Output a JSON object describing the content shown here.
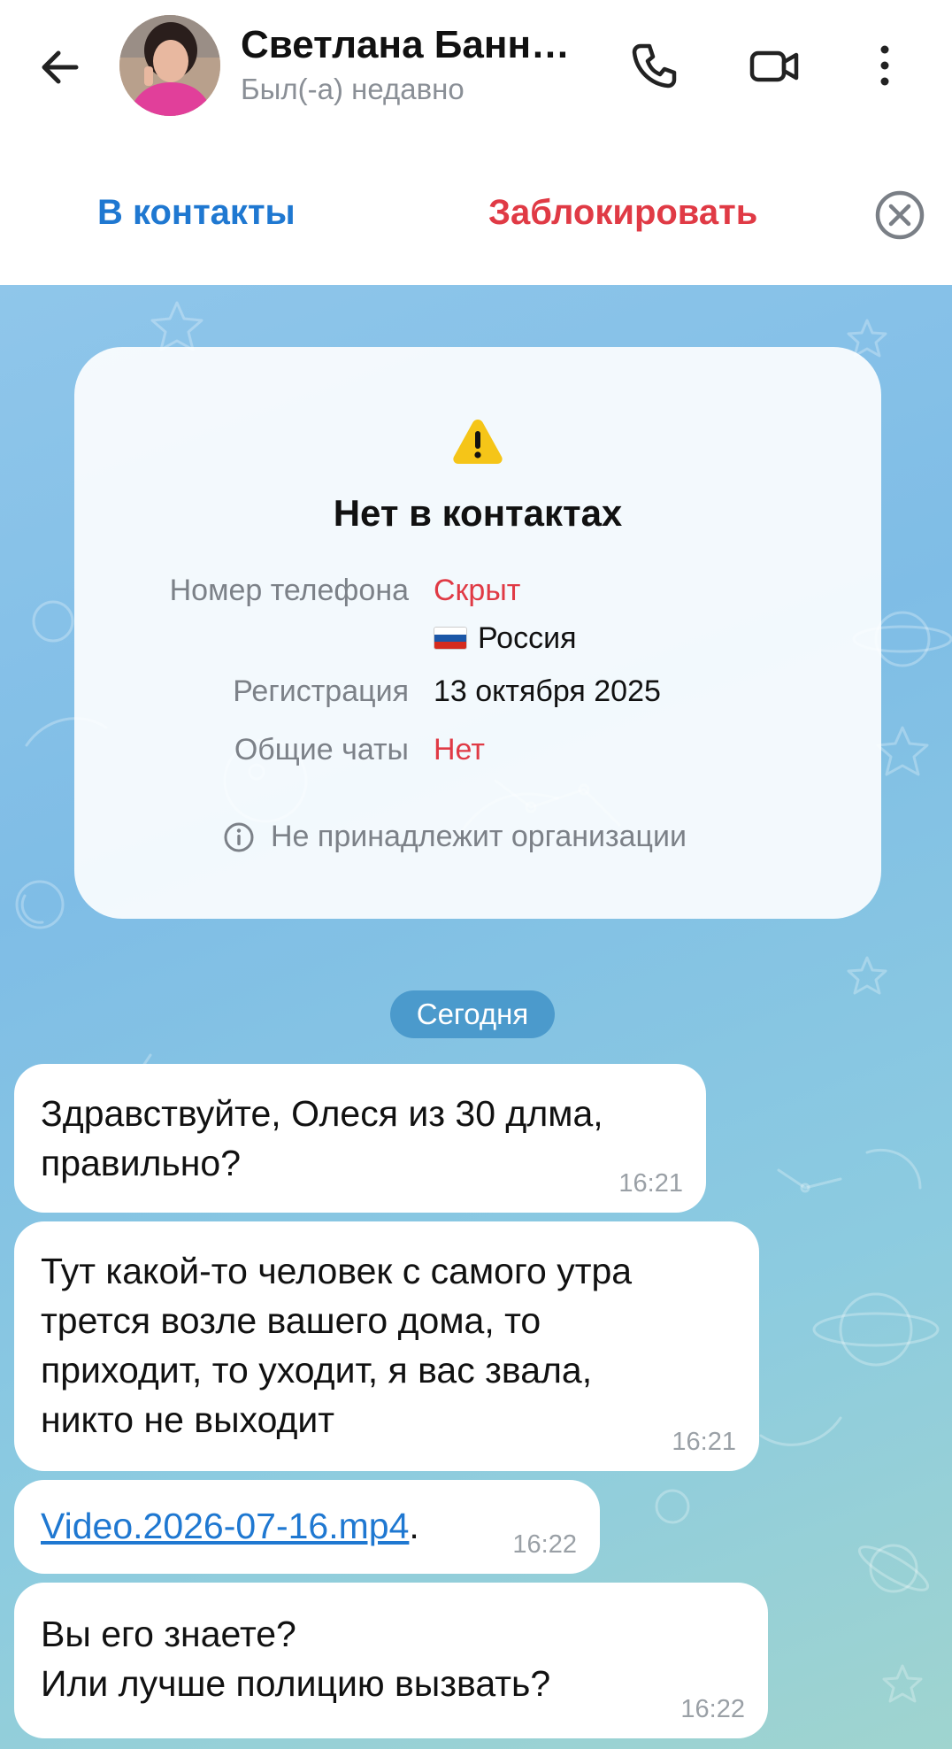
{
  "header": {
    "title": "Светлана Банн…",
    "status": "Был(-а) недавно"
  },
  "actions": {
    "add_contact": "В контакты",
    "block": "Заблокировать"
  },
  "info_card": {
    "title": "Нет в контактах",
    "phone_label": "Номер телефона",
    "phone_value": "Скрыт",
    "country": "Россия",
    "registration_label": "Регистрация",
    "registration_value": "13 октября 2025",
    "common_chats_label": "Общие чаты",
    "common_chats_value": "Нет",
    "organization_note": "Не принадлежит организации"
  },
  "date_separator": "Сегодня",
  "messages": [
    {
      "lines": [
        "Здравствуйте, Олеся из 30 длма,",
        "правильно?"
      ],
      "time": "16:21"
    },
    {
      "lines": [
        "Тут какой-то человек с самого утра",
        "трется возле вашего дома, то",
        "приходит, то уходит, я вас звала,",
        "никто не выходит"
      ],
      "time": "16:21"
    },
    {
      "link": "Video.2026-07-16.mp4",
      "suffix": ".",
      "time": "16:22"
    },
    {
      "lines": [
        "Вы его знаете?",
        "Или лучше полицию вызвать?"
      ],
      "time": "16:22"
    }
  ],
  "colors": {
    "accent_blue": "#1f78d1",
    "danger_red": "#e03a45",
    "warning_yellow": "#f5c518"
  }
}
